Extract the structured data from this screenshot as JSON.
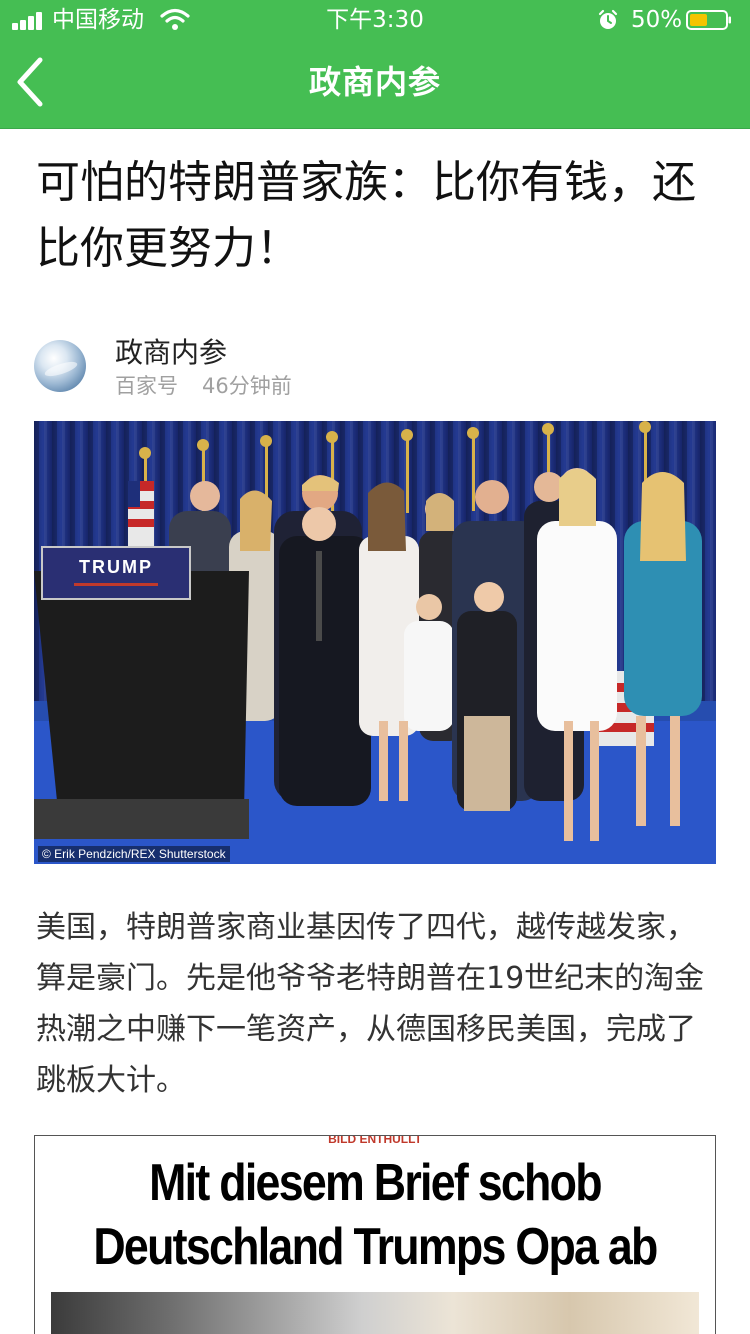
{
  "status_bar": {
    "carrier": "中国移动",
    "time": "下午3:30",
    "battery_percent": "50%",
    "battery_level": 0.5
  },
  "nav": {
    "title": "政商内参"
  },
  "article": {
    "title": "可怕的特朗普家族：比你有钱，还比你更努力！",
    "author": {
      "name": "政商内参",
      "source": "百家号",
      "time_ago": "46分钟前"
    },
    "photo": {
      "podium_sign": "TRUMP",
      "credit": "© Erik Pendzich/REX Shutterstock"
    },
    "paragraph": "美国，特朗普家商业基因传了四代，越传越发家，算是豪门。先是他爷爷老特朗普在19世纪末的淘金热潮之中赚下一笔资产，从德国移民美国，完成了跳板大计。",
    "newspaper_clip": {
      "kicker": "BILD ENTHÜLLT",
      "headline_line1": "Mit diesem Brief schob",
      "headline_line2": "Deutschland Trumps Opa ab"
    }
  },
  "colors": {
    "header_green": "#45be53",
    "battery_yellow": "#f5c400"
  }
}
